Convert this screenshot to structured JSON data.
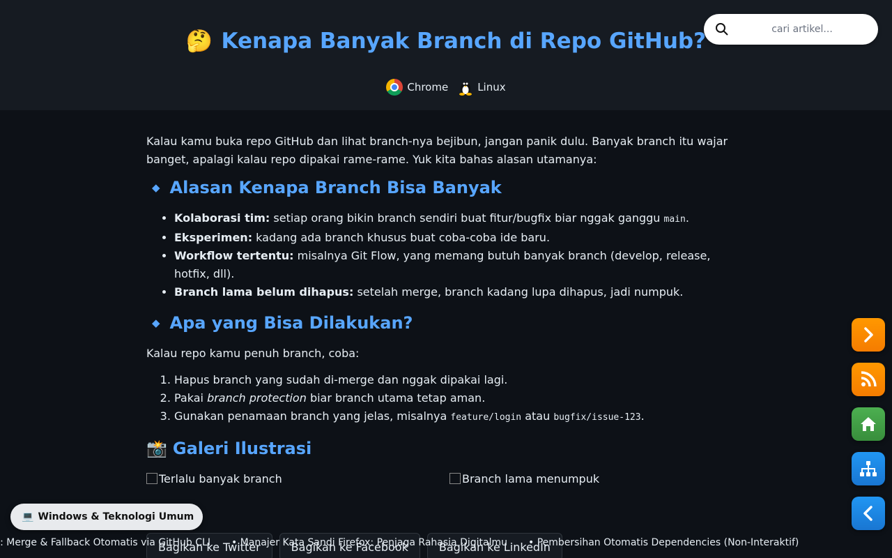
{
  "header": {
    "title_emoji": "🤔",
    "title": "Kenapa Banyak Branch di Repo GitHub?",
    "platforms": [
      {
        "icon": "chrome-icon",
        "label": "Chrome"
      },
      {
        "icon": "linux-icon",
        "label": "Linux"
      }
    ]
  },
  "search": {
    "placeholder": "cari artikel..."
  },
  "article": {
    "intro": "Kalau kamu buka repo GitHub dan lihat branch-nya bejibun, jangan panik dulu. Banyak branch itu wajar banget, apalagi kalau repo dipakai rame-rame. Yuk kita bahas alasan utamanya:",
    "section1": {
      "heading": "Alasan Kenapa Branch Bisa Banyak",
      "items": [
        {
          "bold": "Kolaborasi tim:",
          "text": " setiap orang bikin branch sendiri buat fitur/bugfix biar nggak ganggu ",
          "code": "main",
          "after": "."
        },
        {
          "bold": "Eksperimen:",
          "text": " kadang ada branch khusus buat coba-coba ide baru."
        },
        {
          "bold": "Workflow tertentu:",
          "text": " misalnya Git Flow, yang memang butuh banyak branch (develop, release, hotfix, dll)."
        },
        {
          "bold": "Branch lama belum dihapus:",
          "text": " setelah merge, branch kadang lupa dihapus, jadi numpuk."
        }
      ]
    },
    "section2": {
      "heading": "Apa yang Bisa Dilakukan?",
      "intro": "Kalau repo kamu penuh branch, coba:",
      "items": [
        {
          "text": "Hapus branch yang sudah di-merge dan nggak dipakai lagi."
        },
        {
          "pre": "Pakai ",
          "em": "branch protection",
          "post": " biar branch utama tetap aman."
        },
        {
          "pre": "Gunakan penamaan branch yang jelas, misalnya ",
          "code1": "feature/login",
          "mid": " atau ",
          "code2": "bugfix/issue-123",
          "post": "."
        }
      ]
    },
    "gallery": {
      "emoji": "📸",
      "heading": "Galeri Ilustrasi",
      "images": [
        "Terlalu banyak branch",
        "Branch lama menumpuk"
      ]
    }
  },
  "share": {
    "twitter": "Bagikan ke Twitter",
    "facebook": "Bagikan ke Facebook",
    "linkedin": "Bagikan ke LinkedIn"
  },
  "ticker": [
    "Otomatis gh-force-merge.sh: Merge & Fallback Otomatis via GitHub CLI",
    "Manajer Kata Sandi Firefox: Penjaga Rahasia Digitalmu",
    "Pembersihan Otomatis Dependencies (Non-Interaktif)"
  ],
  "category": {
    "emoji": "💻",
    "label": "Windows & Teknologi Umum"
  },
  "fabs": [
    {
      "icon": "chevron-right-icon",
      "color": "#fb8c00"
    },
    {
      "icon": "rss-icon",
      "color": "#fb8c00"
    },
    {
      "icon": "home-icon",
      "color": "#43a047"
    },
    {
      "icon": "sitemap-icon",
      "color": "#1e88e5"
    },
    {
      "icon": "chevron-left-icon",
      "color": "#1e88e5"
    }
  ]
}
